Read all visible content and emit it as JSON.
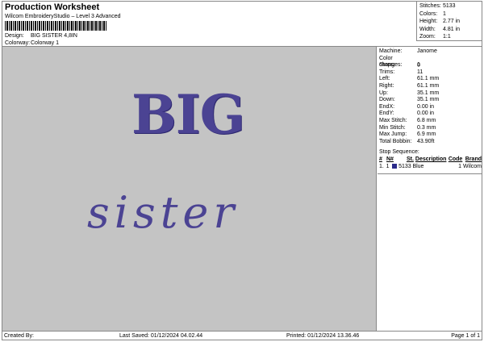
{
  "header": {
    "title": "Production Worksheet",
    "subtitle": "Wilcom EmbroideryStudio – Level 3 Advanced",
    "design_label": "Design:",
    "design": "BIG SISTER 4,8IN",
    "colorway_label": "Colorway:",
    "colorway": "Colorway 1"
  },
  "stats": [
    {
      "k": "Stitches:",
      "v": "5133"
    },
    {
      "k": "Colors:",
      "v": "1"
    },
    {
      "k": "Height:",
      "v": "2.77 in"
    },
    {
      "k": "Width:",
      "v": "4.81 in"
    },
    {
      "k": "Zoom:",
      "v": "1:1"
    }
  ],
  "artwork": {
    "line1": "BIG",
    "line2": "sister",
    "thread_color": "#4b4393"
  },
  "details": [
    {
      "k": "Machine:",
      "v": "Janome"
    },
    {
      "k": "Color changes:",
      "v": "0"
    },
    {
      "k": "Stops:",
      "v": "1"
    },
    {
      "k": "Trims:",
      "v": "11"
    },
    {
      "k": "Left:",
      "v": "61.1 mm"
    },
    {
      "k": "Right:",
      "v": "61.1 mm"
    },
    {
      "k": "Up:",
      "v": "35.1 mm"
    },
    {
      "k": "Down:",
      "v": "35.1 mm"
    },
    {
      "k": "EndX:",
      "v": "0.00 in"
    },
    {
      "k": "EndY:",
      "v": "0.00 in"
    },
    {
      "k": "Max Stitch:",
      "v": "6.8 mm"
    },
    {
      "k": "Min Stitch:",
      "v": "0.3 mm"
    },
    {
      "k": "Max Jump:",
      "v": "6.9 mm"
    },
    {
      "k": "Total Bobbin:",
      "v": "43.90ft"
    }
  ],
  "stop_sequence": {
    "title": "Stop Sequence:",
    "headers": [
      "#",
      "N#",
      "St.",
      "Description",
      "Code",
      "Brand"
    ],
    "rows": [
      {
        "num": "1.",
        "n": "1",
        "st": "5133",
        "desc": "Blue",
        "code": "1",
        "brand": "Wilcom",
        "swatch": "#2a2a8a"
      }
    ]
  },
  "footer": {
    "created": "Created By:",
    "saved": "Last Saved: 01/12/2024 04.02.44",
    "printed": "Printed: 01/12/2024 13.36.46",
    "page": "Page 1 of 1"
  }
}
